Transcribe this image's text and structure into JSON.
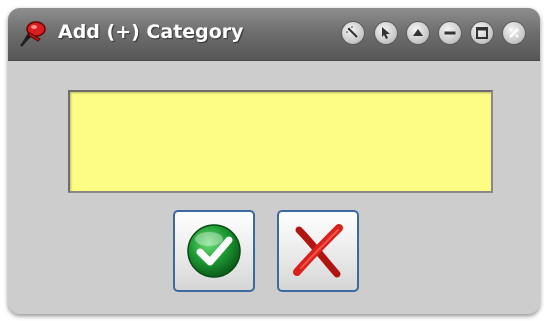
{
  "window": {
    "title": "Add (+) Category"
  },
  "titlebar_buttons": [
    {
      "name": "settings-wand-icon"
    },
    {
      "name": "cursor-arrow-icon"
    },
    {
      "name": "collapse-up-icon"
    },
    {
      "name": "minimize-icon"
    },
    {
      "name": "maximize-icon"
    },
    {
      "name": "close-icon"
    }
  ],
  "form": {
    "category_value": "",
    "category_placeholder": ""
  },
  "actions": {
    "confirm_icon": "green-check-icon",
    "cancel_icon": "red-x-icon"
  },
  "colors": {
    "field_bg": "#fdfd85",
    "confirm": "#1e9a33",
    "cancel": "#d8211c",
    "button_border": "#3c6a9e"
  }
}
